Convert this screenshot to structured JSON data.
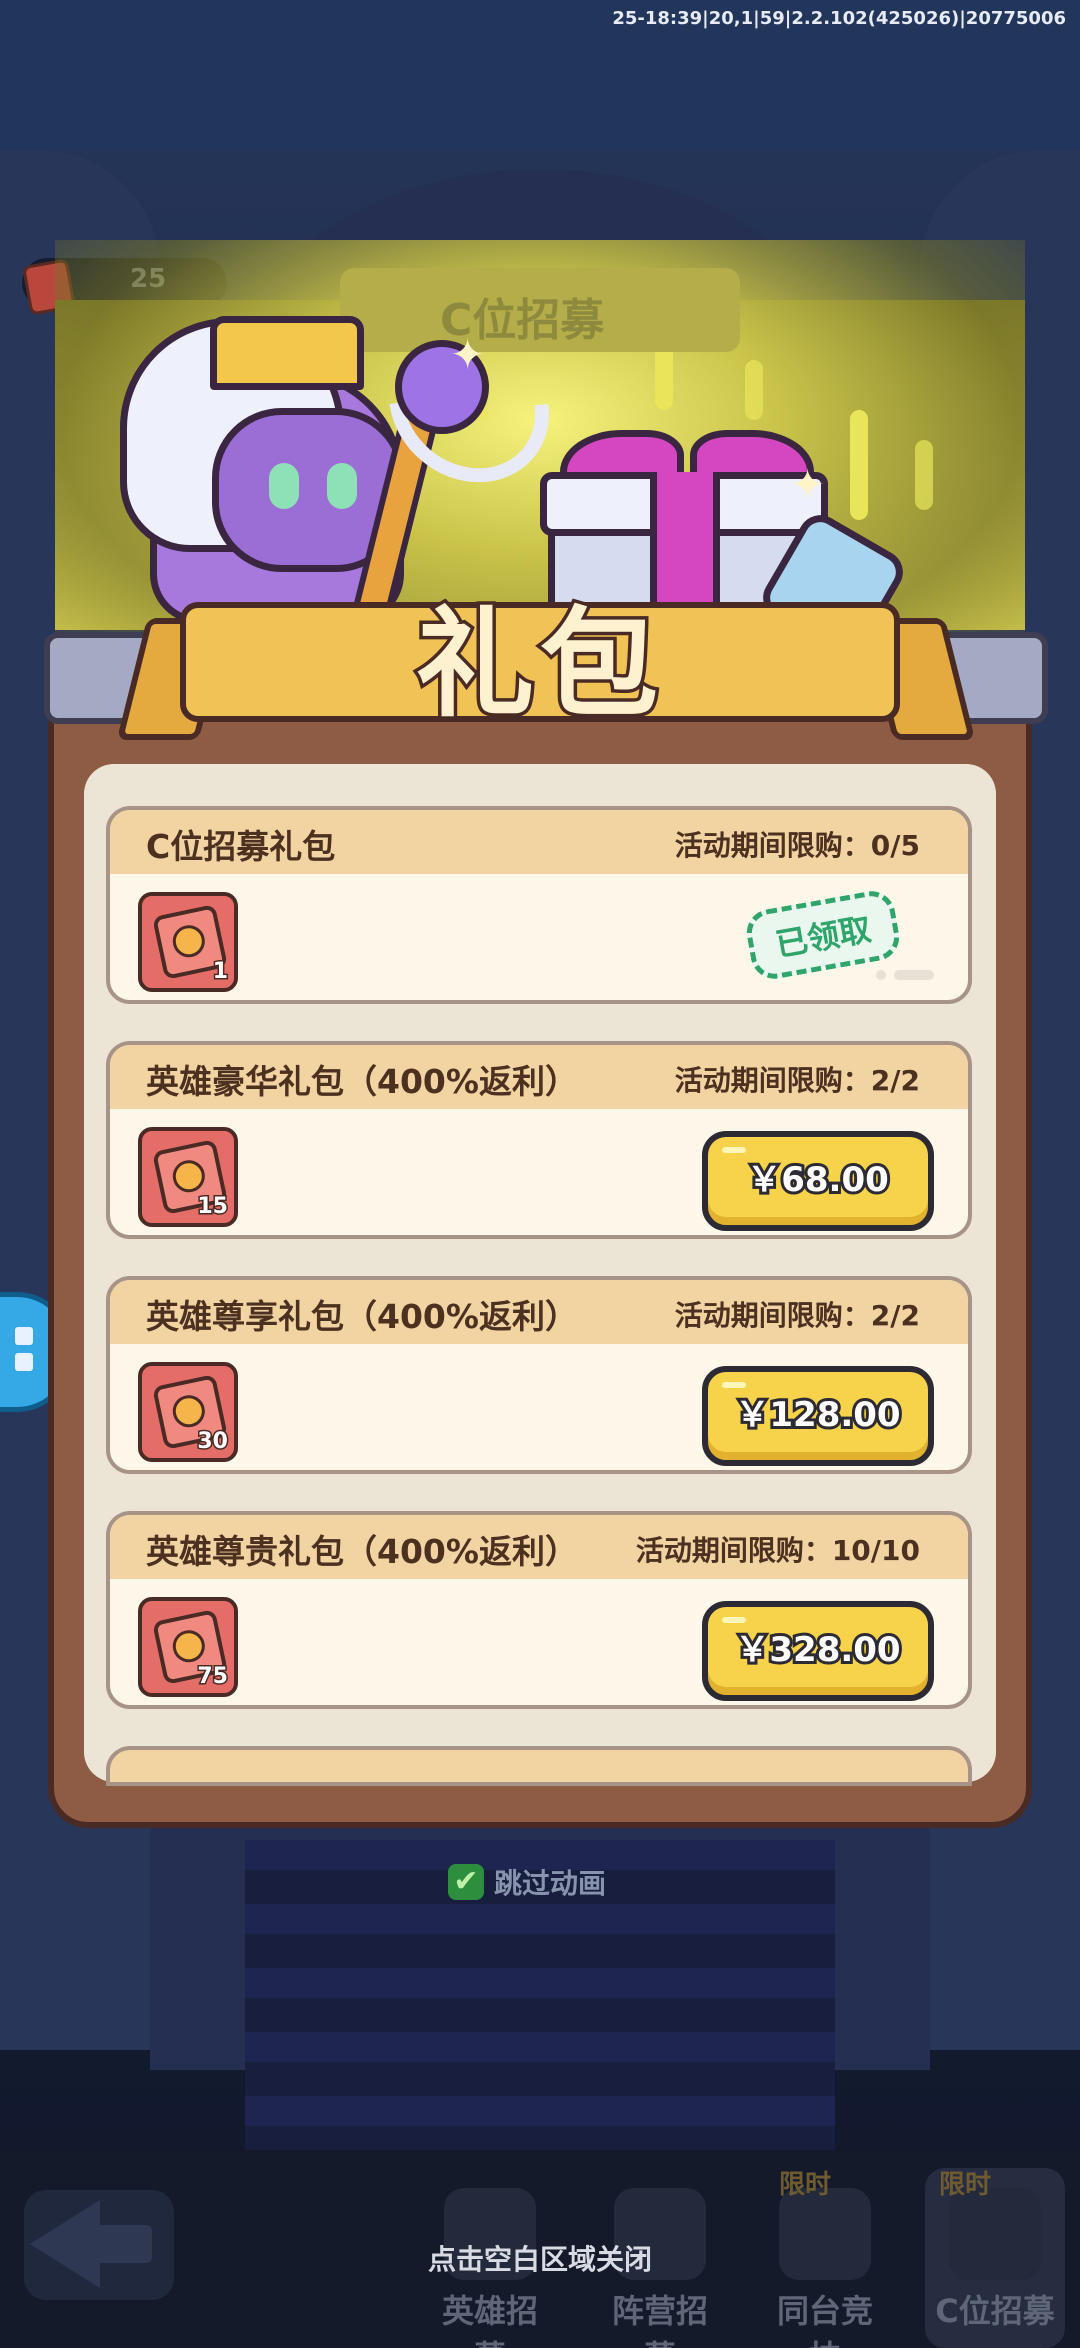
{
  "status": {
    "debug_text": "25-18:39|20,1|59|2.2.102(425026)|20775006"
  },
  "background": {
    "coin_count": "25",
    "banner_title": "C位招募",
    "skip_animation": "跳过动画",
    "bottom_nav": [
      {
        "label": "英雄招募",
        "badge": ""
      },
      {
        "label": "阵营招募",
        "badge": ""
      },
      {
        "label": "同台竞技",
        "badge": "限时"
      },
      {
        "label": "C位招募",
        "badge": "限时"
      }
    ]
  },
  "popup": {
    "title": "礼包",
    "packs": [
      {
        "name": "C位招募礼包",
        "limit": "活动期间限购：0/5",
        "item_count": "1",
        "state": "claimed",
        "claimed_label": "已领取",
        "price": ""
      },
      {
        "name": "英雄豪华礼包（400%返利）",
        "limit": "活动期间限购：2/2",
        "item_count": "15",
        "state": "buy",
        "price": "￥68.00"
      },
      {
        "name": "英雄尊享礼包（400%返利）",
        "limit": "活动期间限购：2/2",
        "item_count": "30",
        "state": "buy",
        "price": "￥128.00"
      },
      {
        "name": "英雄尊贵礼包（400%返利）",
        "limit": "活动期间限购：10/10",
        "item_count": "75",
        "state": "buy",
        "price": "￥328.00"
      }
    ]
  },
  "close_hint": "点击空白区域关闭",
  "colors": {
    "buy_button": "#f6d34a",
    "claimed_stamp": "#2fa46b",
    "panel": "#8e5b45",
    "ribbon": "#f1c356"
  }
}
